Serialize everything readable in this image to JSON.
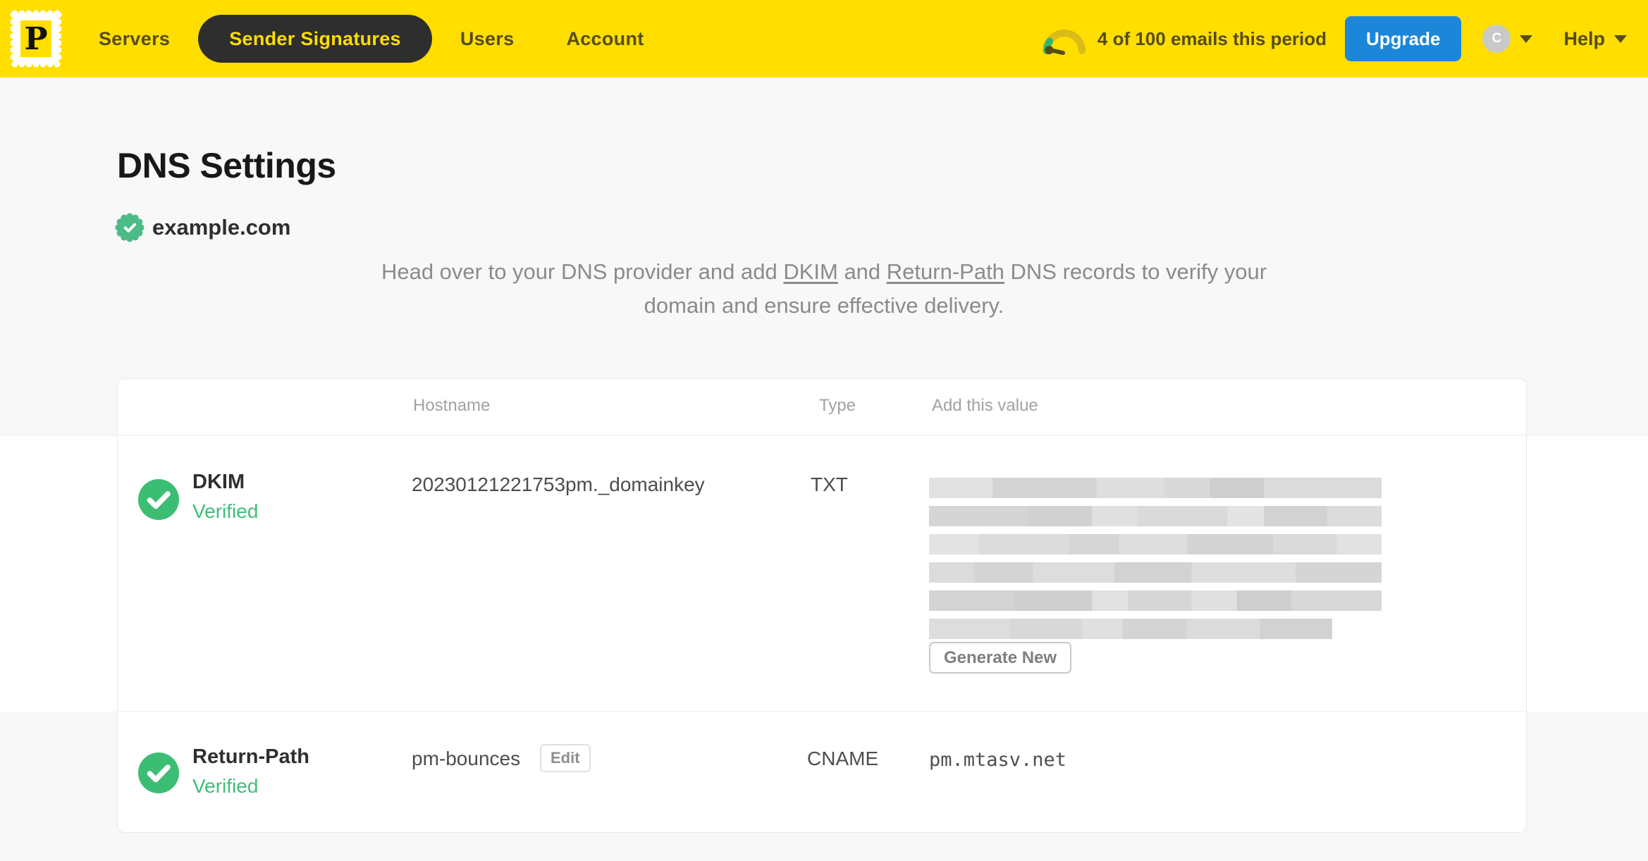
{
  "header": {
    "logo_letter": "P",
    "nav": [
      {
        "label": "Servers",
        "active": false
      },
      {
        "label": "Sender Signatures",
        "active": true
      },
      {
        "label": "Users",
        "active": false
      },
      {
        "label": "Account",
        "active": false
      }
    ],
    "usage_text": "4 of 100 emails this period",
    "upgrade_label": "Upgrade",
    "avatar_initial": "C",
    "help_label": "Help"
  },
  "page": {
    "title": "DNS Settings",
    "domain": "example.com",
    "domain_verified": true,
    "intro": {
      "part1": "Head over to your DNS provider and add ",
      "link_dkim": "DKIM",
      "part2": " and ",
      "link_return_path": "Return-Path",
      "part3": " DNS records to verify your domain and ensure effective delivery."
    }
  },
  "dns_table": {
    "columns": {
      "hostname": "Hostname",
      "type": "Type",
      "value": "Add this value"
    },
    "rows": [
      {
        "name": "DKIM",
        "status": "Verified",
        "hostname": "20230121221753pm._domainkey",
        "record_type": "TXT",
        "value_redacted": true,
        "action_label": "Generate New"
      },
      {
        "name": "Return-Path",
        "status": "Verified",
        "hostname": "pm-bounces",
        "edit_label": "Edit",
        "record_type": "CNAME",
        "value": "pm.mtasv.net"
      }
    ]
  },
  "colors": {
    "brand_yellow": "#FFDE00",
    "nav_active_bg": "#2E2E2E",
    "header_text": "#564C18",
    "upgrade_blue": "#1C86D8",
    "verified_green": "#3FBE78",
    "seal_green": "#4CBB85",
    "page_bg": "#F8F8F8"
  }
}
